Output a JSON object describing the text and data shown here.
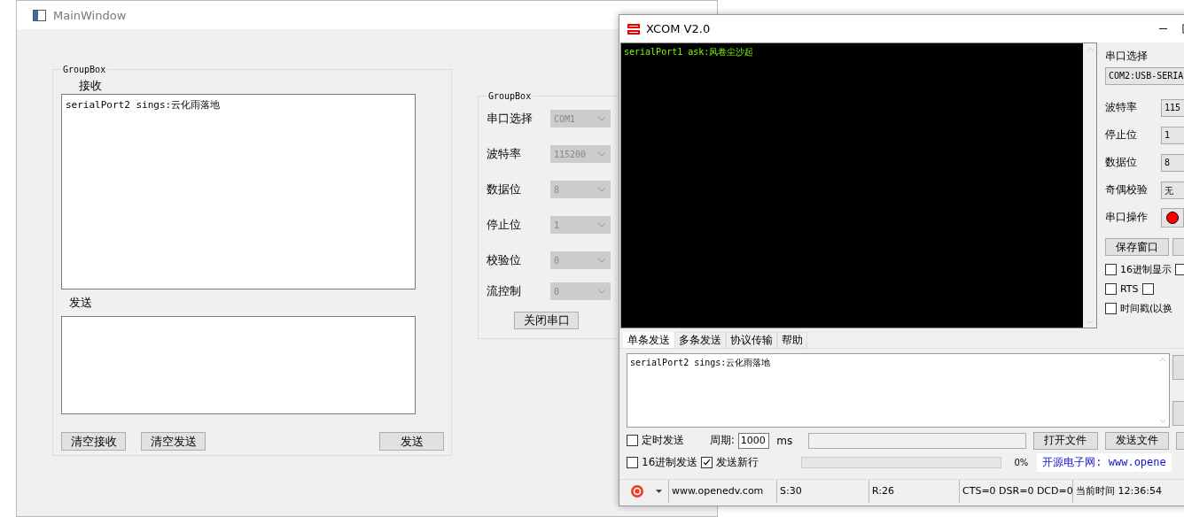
{
  "main_window": {
    "title": "MainWindow",
    "receive_group": {
      "title": "GroupBox",
      "receive_label": "接收",
      "receive_text": "serialPort2 sings:云化雨落地",
      "send_label": "发送",
      "buttons": [
        "清空接收",
        "清空发送",
        "发送"
      ]
    },
    "settings_group": {
      "title": "GroupBox",
      "fields": [
        {
          "label": "串口选择",
          "value": "COM1",
          "disabled": true
        },
        {
          "label": "波特率",
          "value": "115200",
          "disabled": true
        },
        {
          "label": "数据位",
          "value": "8",
          "disabled": true
        },
        {
          "label": "停止位",
          "value": "1",
          "disabled": true
        },
        {
          "label": "校验位",
          "value": "0",
          "disabled": true
        },
        {
          "label": "流控制",
          "value": "0",
          "disabled": true
        }
      ],
      "button": "关闭串口"
    }
  },
  "xcom": {
    "title": "XCOM V2.0",
    "terminal_text": "serialPort1 ask:风卷尘沙起",
    "port_label": "串口选择",
    "port_value": "COM2:USB-SERIA",
    "settings": [
      {
        "label": "波特率",
        "value": "115"
      },
      {
        "label": "停止位",
        "value": "1"
      },
      {
        "label": "数据位",
        "value": "8"
      },
      {
        "label": "奇偶校验",
        "value": "无"
      }
    ],
    "operation_label": "串口操作",
    "port_open": true,
    "save_button": "保存窗口",
    "options": [
      {
        "label": "16进制显示",
        "checked": false,
        "extra": {
          "checked": false
        }
      },
      {
        "label": "RTS",
        "checked": false,
        "extra": {
          "checked": false
        }
      },
      {
        "label": "时间戳(以换",
        "checked": false
      }
    ],
    "tabs": [
      {
        "label": "单条发送",
        "selected": true
      },
      {
        "label": "多条发送",
        "selected": false
      },
      {
        "label": "协议传输",
        "selected": false
      },
      {
        "label": "帮助",
        "selected": false
      }
    ],
    "send_text": "serialPort2 sings:云化雨落地",
    "timed_send": {
      "label": "定时发送",
      "checked": false
    },
    "period_label": "周期:",
    "period_value": "1000",
    "period_unit": "ms",
    "file_buttons": [
      "打开文件",
      "发送文件"
    ],
    "hex_send": {
      "label": "16进制发送",
      "checked": false
    },
    "new_line": {
      "label": "发送新行",
      "checked": true
    },
    "progress": {
      "level": 0,
      "reading": "0%"
    },
    "banner": "开源电子网: www.opene",
    "status_bar": [
      "www.openedv.com",
      "S:30",
      "R:26",
      "CTS=0 DSR=0 DCD=0",
      "当前时间 12:36:54"
    ]
  }
}
